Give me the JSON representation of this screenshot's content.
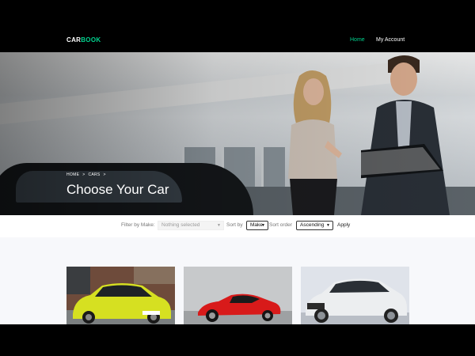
{
  "nav": {
    "brand_part1": "CAR",
    "brand_part2": "BOOK",
    "items": [
      {
        "label": "Home",
        "active": true
      },
      {
        "label": "My Account",
        "active": false
      }
    ]
  },
  "hero": {
    "breadcrumb": [
      "HOME",
      ">",
      "CARS",
      ">"
    ],
    "title": "Choose Your Car"
  },
  "filters": {
    "make_label": "Filter by Make:",
    "make_placeholder": "Nothing selected",
    "sort_by_label": "Sort by",
    "sort_by_value": "Make",
    "sort_order_label": "Sort order",
    "sort_order_value": "Ascending",
    "apply_label": "Apply"
  },
  "cars": [
    {
      "color_name": "yellow",
      "color": "#d6e021"
    },
    {
      "color_name": "red",
      "color": "#d81a1a"
    },
    {
      "color_name": "white",
      "color": "#eceef0"
    }
  ],
  "colors": {
    "accent": "#01d28e",
    "nav_bg": "#000000",
    "content_bg": "#f7f8fb"
  }
}
